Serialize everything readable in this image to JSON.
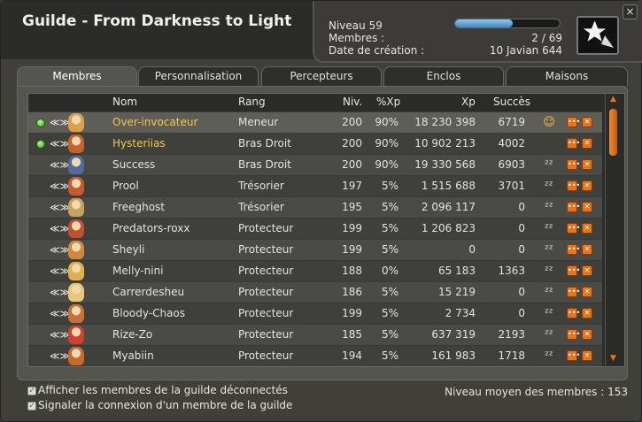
{
  "header": {
    "title": "Guilde - From Darkness to Light",
    "level_label": "Niveau 59",
    "members_label": "Membres :",
    "members_value": "2 / 69",
    "created_label": "Date de création :",
    "created_value": "10 Javian 644",
    "level_progress": 0.55,
    "close_label": "×"
  },
  "tabs": [
    "Membres",
    "Personnalisation",
    "Percepteurs",
    "Enclos",
    "Maisons"
  ],
  "columns": [
    "Nom",
    "Rang",
    "Niv.",
    "%Xp",
    "Xp",
    "Succès"
  ],
  "rows": [
    {
      "name": "Over-invocateur",
      "rank": "Meneur",
      "lvl": "200",
      "pxp": "90%",
      "xp": "18 230 398",
      "succ": "6719",
      "online": true,
      "name_color": "#f5c84b",
      "mood": "face",
      "selected": true
    },
    {
      "name": "Hysteriias",
      "rank": "Bras Droit",
      "lvl": "200",
      "pxp": "90%",
      "xp": "10 902 213",
      "succ": "4002",
      "online": true,
      "name_color": "#f5c84b",
      "mood": ""
    },
    {
      "name": "Success",
      "rank": "Bras Droit",
      "lvl": "200",
      "pxp": "90%",
      "xp": "19 330 568",
      "succ": "6903",
      "online": false,
      "name_color": "#e4e4de",
      "mood": "zzz"
    },
    {
      "name": "Prool",
      "rank": "Trésorier",
      "lvl": "197",
      "pxp": "5%",
      "xp": "1 515 688",
      "succ": "3701",
      "online": false,
      "name_color": "#e4e4de",
      "mood": "zzz"
    },
    {
      "name": "Freeghost",
      "rank": "Trésorier",
      "lvl": "195",
      "pxp": "5%",
      "xp": "2 096 117",
      "succ": "0",
      "online": false,
      "name_color": "#e4e4de",
      "mood": "zzz"
    },
    {
      "name": "Predators-roxx",
      "rank": "Protecteur",
      "lvl": "199",
      "pxp": "5%",
      "xp": "1 206 823",
      "succ": "0",
      "online": false,
      "name_color": "#e4e4de",
      "mood": "zzz"
    },
    {
      "name": "Sheyli",
      "rank": "Protecteur",
      "lvl": "199",
      "pxp": "5%",
      "xp": "0",
      "succ": "0",
      "online": false,
      "name_color": "#e4e4de",
      "mood": "zzz"
    },
    {
      "name": "Melly-nini",
      "rank": "Protecteur",
      "lvl": "188",
      "pxp": "0%",
      "xp": "65 183",
      "succ": "1363",
      "online": false,
      "name_color": "#e4e4de",
      "mood": "zzz"
    },
    {
      "name": "Carrerdesheu",
      "rank": "Protecteur",
      "lvl": "186",
      "pxp": "5%",
      "xp": "15 219",
      "succ": "0",
      "online": false,
      "name_color": "#e4e4de",
      "mood": "zzz"
    },
    {
      "name": "Bloody-Chaos",
      "rank": "Protecteur",
      "lvl": "199",
      "pxp": "5%",
      "xp": "2 734",
      "succ": "0",
      "online": false,
      "name_color": "#e4e4de",
      "mood": "zzz"
    },
    {
      "name": "Rize-Zo",
      "rank": "Protecteur",
      "lvl": "185",
      "pxp": "5%",
      "xp": "637 319",
      "succ": "2193",
      "online": false,
      "name_color": "#e4e4de",
      "mood": "zzz"
    },
    {
      "name": "Myabiin",
      "rank": "Protecteur",
      "lvl": "194",
      "pxp": "5%",
      "xp": "161 983",
      "succ": "1718",
      "online": false,
      "name_color": "#e4e4de",
      "mood": "zzz"
    }
  ],
  "footer": {
    "opt1": "Afficher les membres de la guilde déconnectés",
    "opt2": "Signaler la connexion d'un membre de la guilde",
    "avg": "Niveau moyen des membres : 153"
  },
  "colors": {
    "accent": "#e8731a",
    "online": "#2aa51c",
    "highlight_name": "#f5c84b"
  }
}
